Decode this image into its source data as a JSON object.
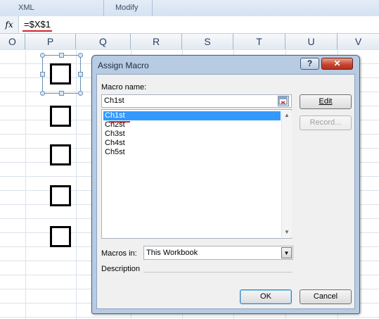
{
  "ribbon": {
    "groups": [
      {
        "label": "XML"
      },
      {
        "label": "Modify"
      }
    ]
  },
  "formula_bar": {
    "fx_label": "fx",
    "formula": "=$X$1"
  },
  "columns": [
    "O",
    "P",
    "Q",
    "R",
    "S",
    "T",
    "U",
    "V"
  ],
  "dialog": {
    "title": "Assign Macro",
    "help_label": "?",
    "close_label": "✕",
    "macro_name_label": "Macro name:",
    "macro_name_value": "Ch1st",
    "macros": [
      "Ch1st",
      "Ch2st",
      "Ch3st",
      "Ch4st",
      "Ch5st"
    ],
    "selected_macro": "Ch1st",
    "buttons": {
      "edit": "Edit",
      "record": "Record...",
      "ok": "OK",
      "cancel": "Cancel"
    },
    "macros_in_label": "Macros in:",
    "macros_in_value": "This Workbook",
    "description_label": "Description"
  },
  "colors": {
    "highlight_red": "#d0242a",
    "selection_blue": "#3399ff"
  }
}
